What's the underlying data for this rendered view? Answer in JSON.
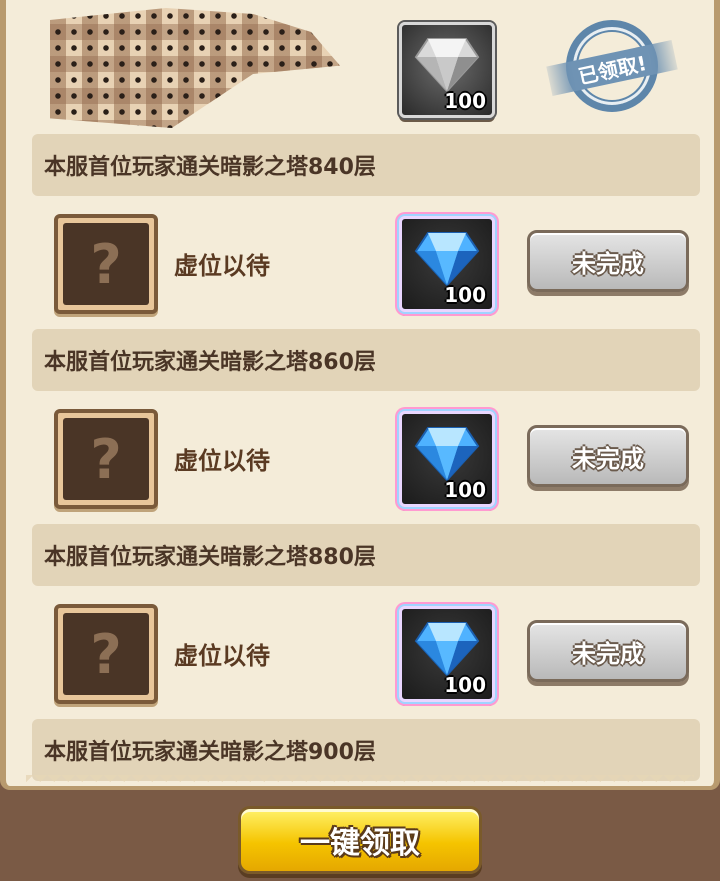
{
  "entries": [
    {
      "player_name": "",
      "reward_qty": "100",
      "reward_type": "gray-gem-icon",
      "status_label": "已领取!",
      "task_label": "本服首位玩家通关暗影之塔840层"
    },
    {
      "player_name": "虚位以待",
      "placeholder_glyph": "?",
      "reward_qty": "100",
      "reward_type": "blue-gem-icon",
      "status_label": "未完成",
      "task_label": "本服首位玩家通关暗影之塔860层"
    },
    {
      "player_name": "虚位以待",
      "placeholder_glyph": "?",
      "reward_qty": "100",
      "reward_type": "blue-gem-icon",
      "status_label": "未完成",
      "task_label": "本服首位玩家通关暗影之塔880层"
    },
    {
      "player_name": "虚位以待",
      "placeholder_glyph": "?",
      "reward_qty": "100",
      "reward_type": "blue-gem-icon",
      "status_label": "未完成",
      "task_label": "本服首位玩家通关暗影之塔900层"
    }
  ],
  "footer": {
    "claim_all_label": "一键领取"
  },
  "colors": {
    "panel_bg": "#f4ecd9",
    "task_bar_bg": "#e2d4b8",
    "incomplete_button": "#cfcfcf",
    "claim_button": "#f5c400",
    "stamp": "#5e86aa"
  }
}
